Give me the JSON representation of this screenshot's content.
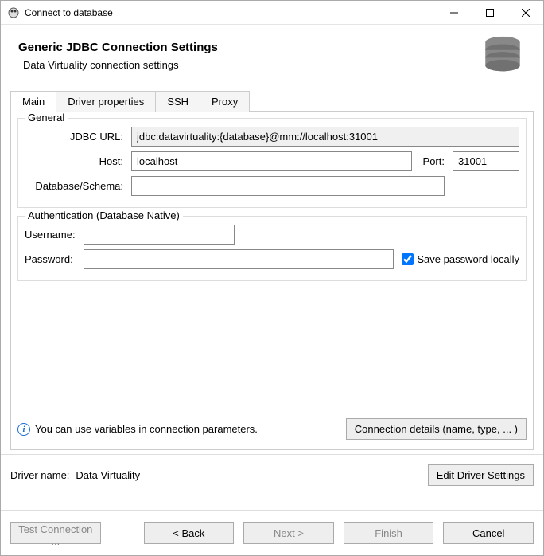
{
  "window": {
    "title": "Connect to database"
  },
  "header": {
    "title": "Generic JDBC Connection Settings",
    "subtitle": "Data Virtuality connection settings"
  },
  "tabs": {
    "main": "Main",
    "driver_properties": "Driver properties",
    "ssh": "SSH",
    "proxy": "Proxy"
  },
  "general": {
    "legend": "General",
    "jdbc_url_label": "JDBC URL:",
    "jdbc_url": "jdbc:datavirtuality:{database}@mm://localhost:31001",
    "host_label": "Host:",
    "host": "localhost",
    "port_label": "Port:",
    "port": "31001",
    "db_label": "Database/Schema:",
    "db": ""
  },
  "auth": {
    "legend": "Authentication (Database Native)",
    "username_label": "Username:",
    "username": "",
    "password_label": "Password:",
    "password": "",
    "save_password_label": "Save password locally",
    "save_password_checked": true
  },
  "info": {
    "hint": "You can use variables in connection parameters.",
    "connection_details_btn": "Connection details (name, type, ... )"
  },
  "driver": {
    "label": "Driver name:",
    "name": "Data Virtuality",
    "edit_btn": "Edit Driver Settings"
  },
  "footer": {
    "test": "Test Connection ...",
    "back": "< Back",
    "next": "Next >",
    "finish": "Finish",
    "cancel": "Cancel"
  }
}
